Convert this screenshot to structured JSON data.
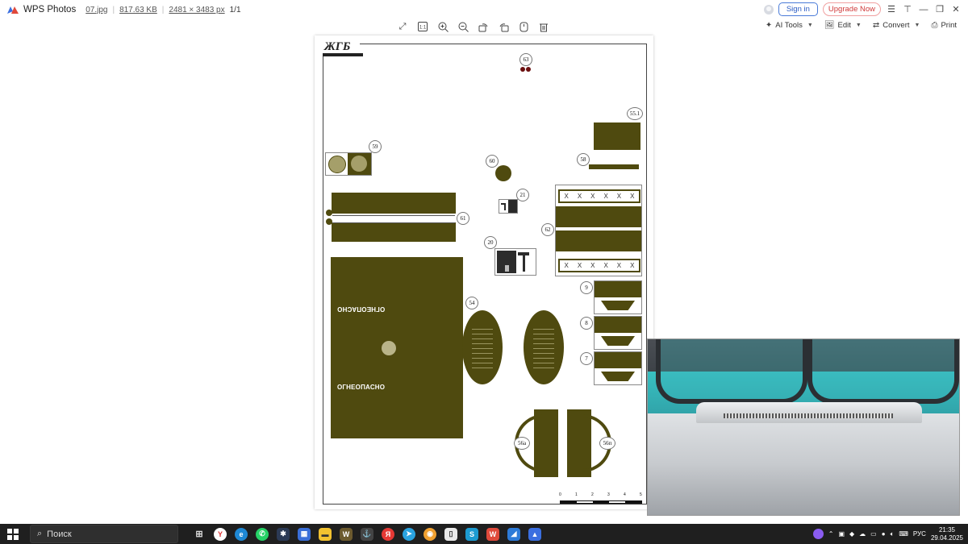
{
  "title_bar": {
    "app_name": "WPS Photos",
    "file_name": "07.jpg",
    "file_size": "817.63 KB",
    "dimensions": "2481 × 3483 px",
    "page_counter": "1/1",
    "sign_in": "Sign in",
    "upgrade": "Upgrade Now"
  },
  "tools": {
    "ai_tools": "AI Tools",
    "edit": "Edit",
    "convert": "Convert",
    "print": "Print"
  },
  "parts": {
    "n63": "63",
    "n551": "55.1",
    "n59": "59",
    "n60": "60",
    "n58": "58",
    "n21": "21",
    "n61": "61",
    "n62": "62",
    "n20": "20",
    "n54": "54",
    "n9": "9",
    "n8": "8",
    "n7": "7",
    "n56a": "56a",
    "n56p": "56п",
    "warning": "ОГНЕОПАСНО",
    "brand_mark": "ЖГБ"
  },
  "ruler": {
    "ticks": [
      "0",
      "1",
      "2",
      "3",
      "4",
      "5"
    ]
  },
  "taskbar": {
    "search_placeholder": "Поиск",
    "language": "РУС",
    "time": "21:35",
    "date": "29.04.2025"
  },
  "colors": {
    "olive": "#4f4a0f",
    "accent_blue": "#2b5cc4",
    "upgrade_red": "#d03a3a",
    "taskbar": "#1f1f1f"
  }
}
